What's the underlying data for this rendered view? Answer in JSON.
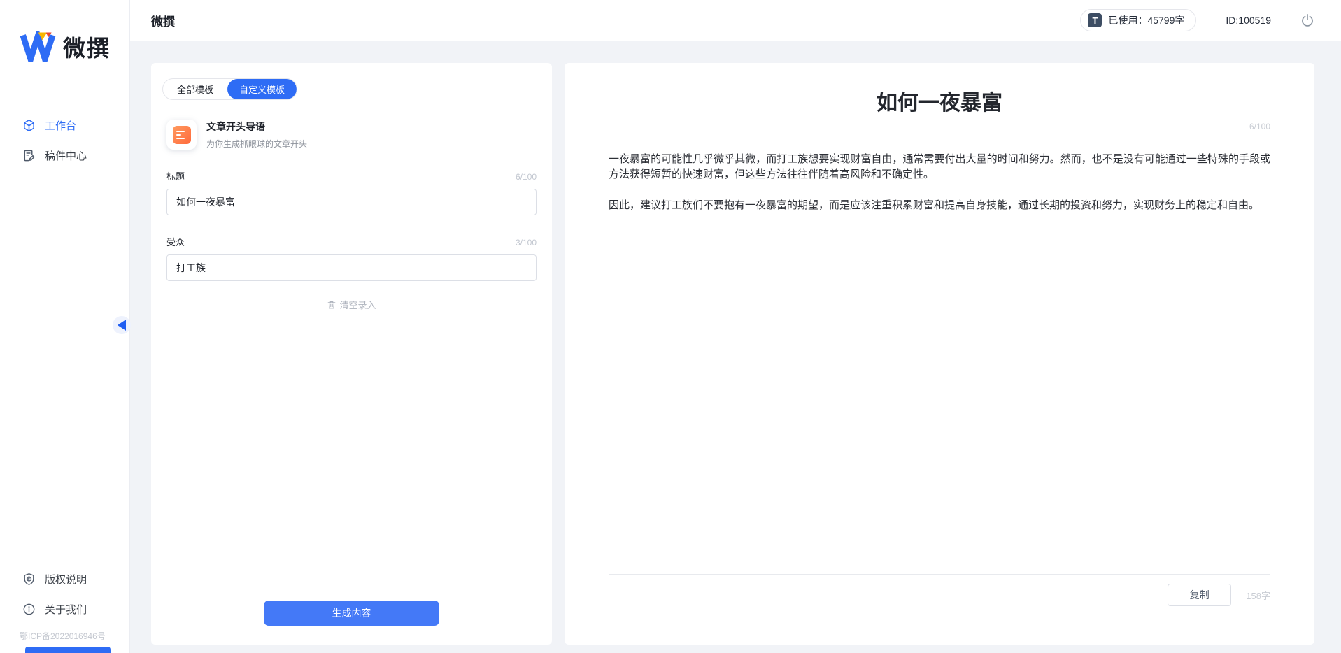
{
  "brand": {
    "logo_text": "微撰"
  },
  "sidebar": {
    "nav": [
      {
        "label": "工作台",
        "icon": "workbench-icon",
        "active": true
      },
      {
        "label": "稿件中心",
        "icon": "drafts-icon",
        "active": false
      }
    ],
    "footer_nav": [
      {
        "label": "版权说明",
        "icon": "copyright-shield-icon"
      },
      {
        "label": "关于我们",
        "icon": "info-icon"
      }
    ],
    "icp": "鄂ICP备2022016946号"
  },
  "header": {
    "title": "微撰",
    "usage_badge": "T",
    "usage_text": "已使用：45799字",
    "user_id": "ID:100519",
    "power_icon": "power-icon"
  },
  "left_panel": {
    "tabs": [
      {
        "label": "全部模板",
        "active": false
      },
      {
        "label": "自定义模板",
        "active": true
      }
    ],
    "template": {
      "icon": "article-doc-icon",
      "title": "文章开头导语",
      "subtitle": "为你生成抓眼球的文章开头"
    },
    "fields": [
      {
        "label": "标题",
        "counter": "6/100",
        "value": "如何一夜暴富"
      },
      {
        "label": "受众",
        "counter": "3/100",
        "value": "打工族"
      }
    ],
    "clear_label": "清空录入",
    "generate_label": "生成内容"
  },
  "result_panel": {
    "title": "如何一夜暴富",
    "counter": "6/100",
    "paragraphs": [
      "一夜暴富的可能性几乎微乎其微，而打工族想要实现财富自由，通常需要付出大量的时间和努力。然而，也不是没有可能通过一些特殊的手段或方法获得短暂的快速财富，但这些方法往往伴随着高风险和不确定性。",
      "因此，建议打工族们不要抱有一夜暴富的期望，而是应该注重积累财富和提高自身技能，通过长期的投资和努力，实现财务上的稳定和自由。"
    ],
    "copy_label": "复制",
    "word_count": "158字"
  },
  "colors": {
    "accent": "#2e6cf5",
    "button": "#4479f7",
    "template_icon": "#ff6a3c"
  }
}
